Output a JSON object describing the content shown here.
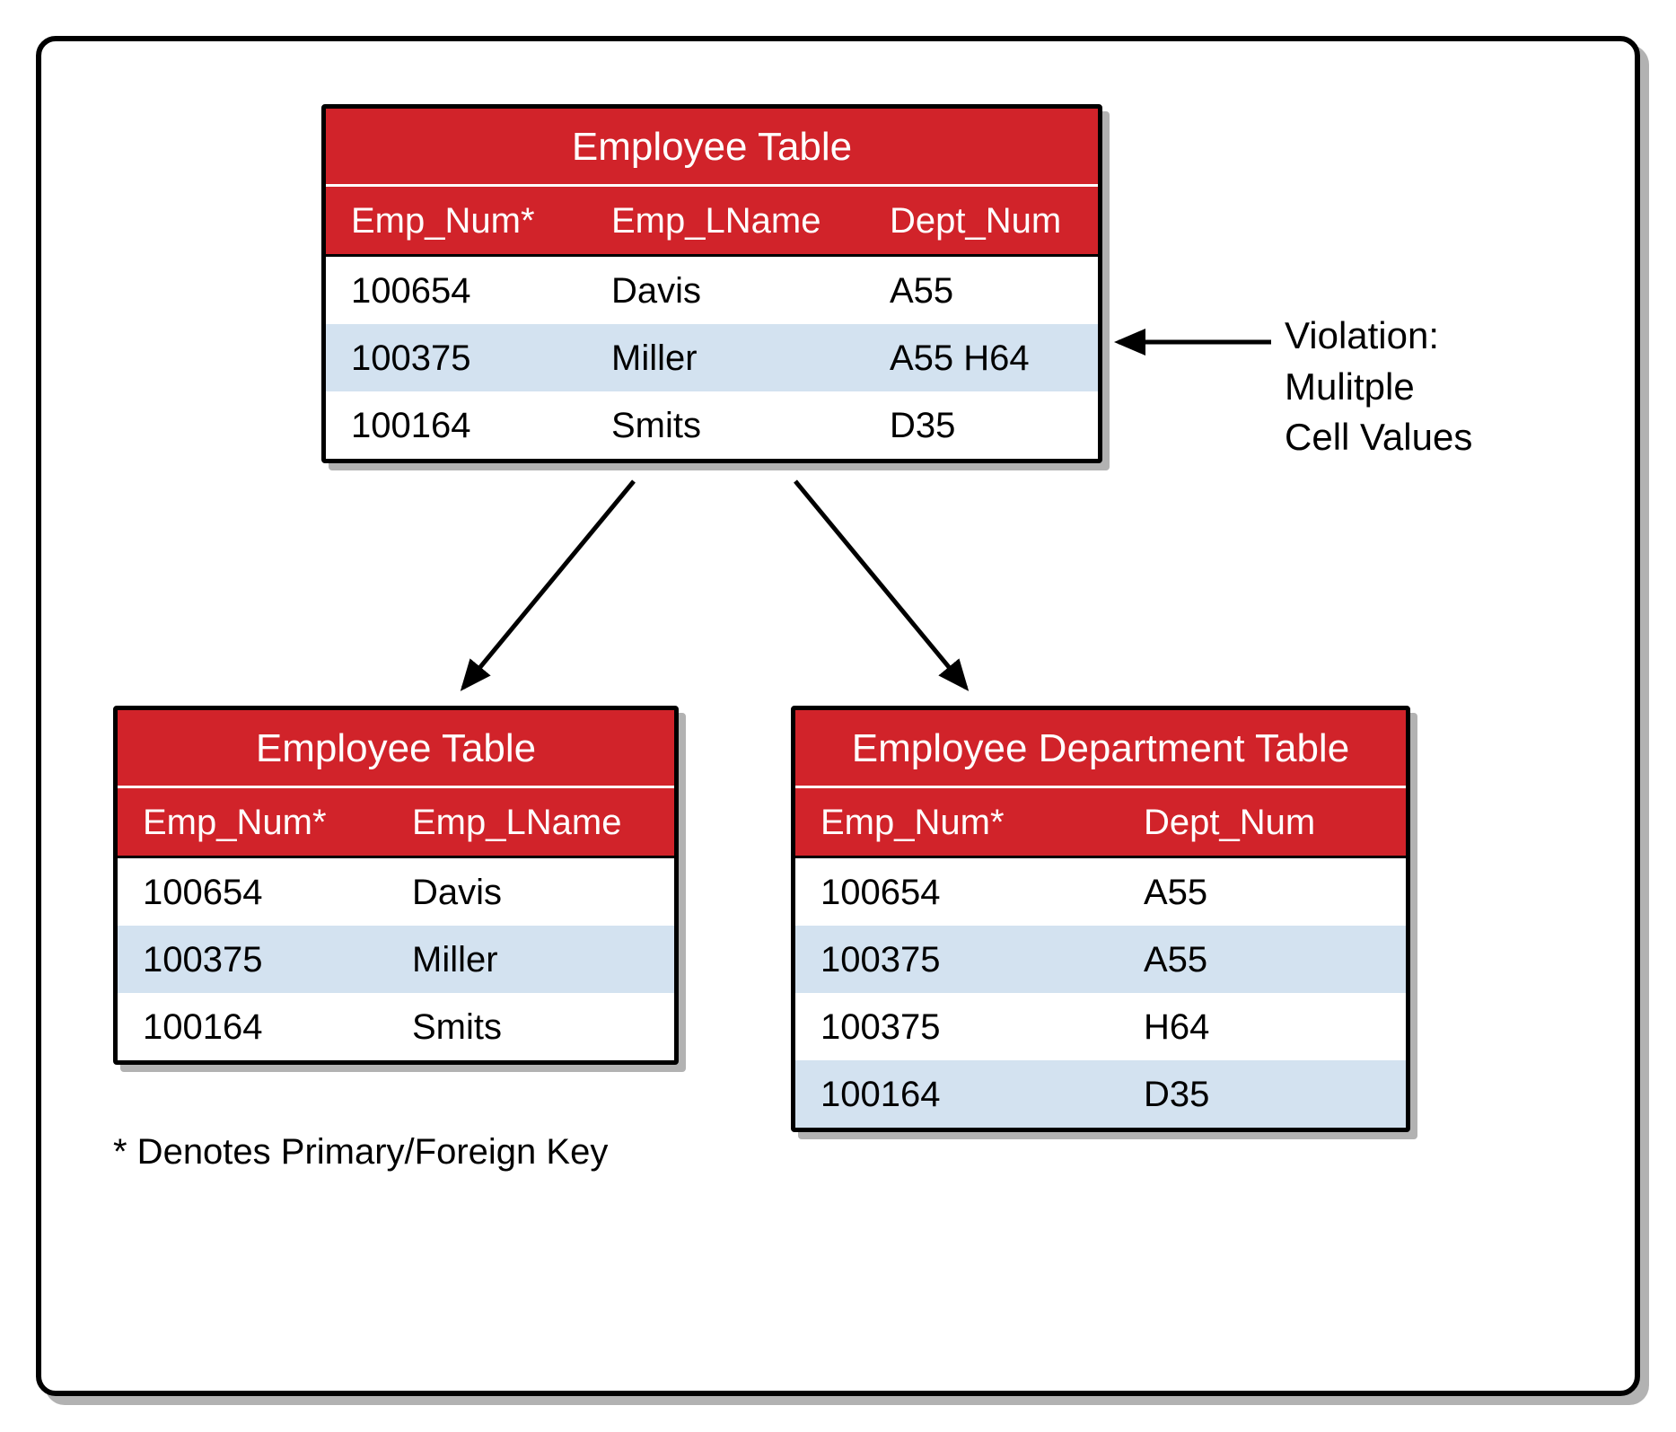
{
  "top_table": {
    "title": "Employee Table",
    "headers": {
      "c1": "Emp_Num*",
      "c2": "Emp_LName",
      "c3": "Dept_Num"
    },
    "rows": [
      {
        "c1": "100654",
        "c2": "Davis",
        "c3": "A55"
      },
      {
        "c1": "100375",
        "c2": "Miller",
        "c3": "A55 H64"
      },
      {
        "c1": "100164",
        "c2": "Smits",
        "c3": "D35"
      }
    ]
  },
  "bottom_left_table": {
    "title": "Employee Table",
    "headers": {
      "c1": "Emp_Num*",
      "c2": "Emp_LName"
    },
    "rows": [
      {
        "c1": "100654",
        "c2": "Davis"
      },
      {
        "c1": "100375",
        "c2": "Miller"
      },
      {
        "c1": "100164",
        "c2": "Smits"
      }
    ]
  },
  "bottom_right_table": {
    "title": "Employee Department Table",
    "headers": {
      "c1": "Emp_Num*",
      "c2": "Dept_Num"
    },
    "rows": [
      {
        "c1": "100654",
        "c2": "A55"
      },
      {
        "c1": "100375",
        "c2": "A55"
      },
      {
        "c1": "100375",
        "c2": "H64"
      },
      {
        "c1": "100164",
        "c2": "D35"
      }
    ]
  },
  "annotation": {
    "line1": "Violation:",
    "line2": "Mulitple",
    "line3": "Cell Values"
  },
  "footnote": "* Denotes Primary/Foreign Key"
}
